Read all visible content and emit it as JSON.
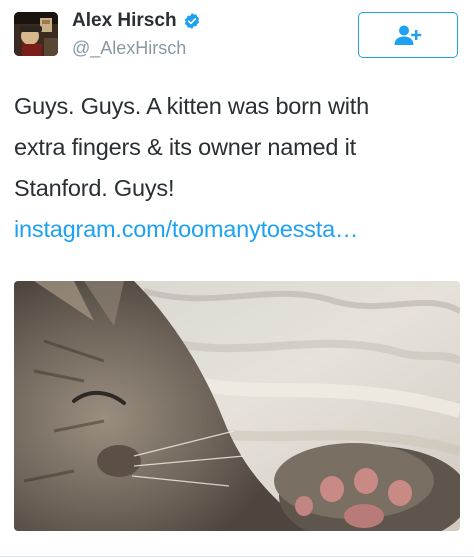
{
  "tweet": {
    "author": {
      "display_name": "Alex Hirsch",
      "handle": "@_AlexHirsch",
      "verified": true,
      "avatar_icon": "profile-photo"
    },
    "follow_button": {
      "icon": "add-user-icon",
      "accent_color": "#1da1f2"
    },
    "text_lines": [
      "Guys. Guys. A kitten was born with",
      "extra fingers & its owner named it",
      "Stanford. Guys!"
    ],
    "link_text": "instagram.com/toomanytoessta…",
    "media": {
      "type": "photo",
      "description_icon": "kitten-photo"
    }
  },
  "colors": {
    "text": "#292f33",
    "secondary": "#8899a6",
    "link": "#1da1f2"
  }
}
